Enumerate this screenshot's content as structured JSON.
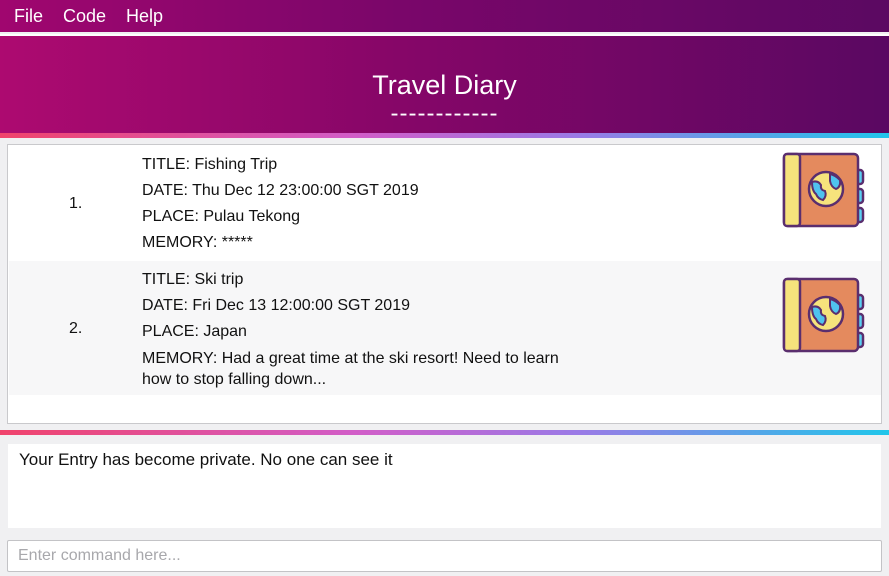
{
  "menu": {
    "items": [
      "File",
      "Code",
      "Help"
    ]
  },
  "header": {
    "title": "Travel Diary",
    "underline": "------------"
  },
  "entries": [
    {
      "index": "1.",
      "title": "TITLE: Fishing Trip",
      "date": "DATE: Thu Dec 12 23:00:00 SGT 2019",
      "place": "PLACE: Pulau Tekong",
      "memory": "MEMORY: *****",
      "icon": "passport-globe-icon"
    },
    {
      "index": "2.",
      "title": "TITLE: Ski trip",
      "date": "DATE: Fri Dec 13 12:00:00 SGT 2019",
      "place": "PLACE: Japan",
      "memory": "MEMORY: Had a great time at the ski resort! Need to learn how to stop falling down...",
      "icon": "passport-globe-icon"
    }
  ],
  "result": {
    "message": "Your Entry has become private. No one can see it"
  },
  "command": {
    "placeholder": "Enter command here...",
    "value": ""
  },
  "colors": {
    "menubar_start": "#a0066f",
    "menubar_end": "#5b0962",
    "book_cover": "#e48a5e",
    "book_spine": "#f6e37c",
    "book_tabs": "#5bd0f3",
    "globe": "#4fc3ef",
    "outline": "#5a2e6e"
  }
}
